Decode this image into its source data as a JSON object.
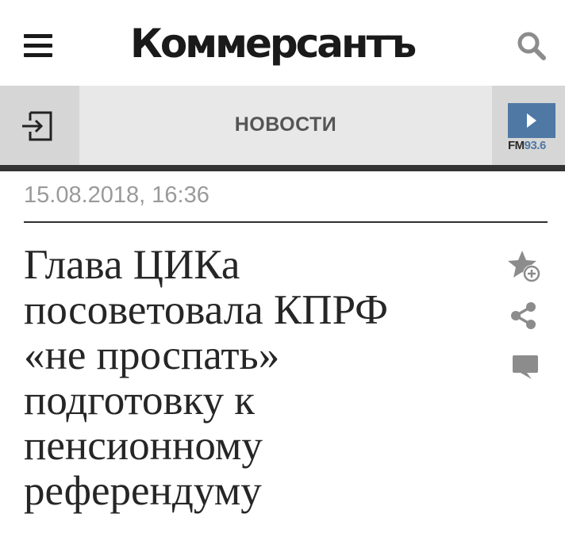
{
  "header": {
    "logo_text": "Коммерсантъ",
    "menu_icon": "hamburger-menu-icon",
    "search_icon": "search-icon"
  },
  "nav": {
    "title": "НОВОСТИ",
    "login_icon": "login-icon",
    "radio": {
      "brand": "FM",
      "frequency": "93.6",
      "icon": "play-icon"
    }
  },
  "article": {
    "timestamp": "15.08.2018, 16:36",
    "headline_lines": [
      "Глава ЦИКа",
      "посоветовала КПРФ",
      "«не проспать»",
      "подготовку к",
      "пенсионному",
      "референдуму"
    ],
    "actions": [
      {
        "icon": "favorite-add-icon"
      },
      {
        "icon": "share-icon"
      },
      {
        "icon": "comment-icon"
      }
    ]
  },
  "colors": {
    "radio_accent": "#4f78a5",
    "nav_background": "#e8e8e8",
    "nav_button_background": "#d6d6d6",
    "timestamp": "#9a9a9a",
    "icon_gray": "#8c8c8c"
  }
}
